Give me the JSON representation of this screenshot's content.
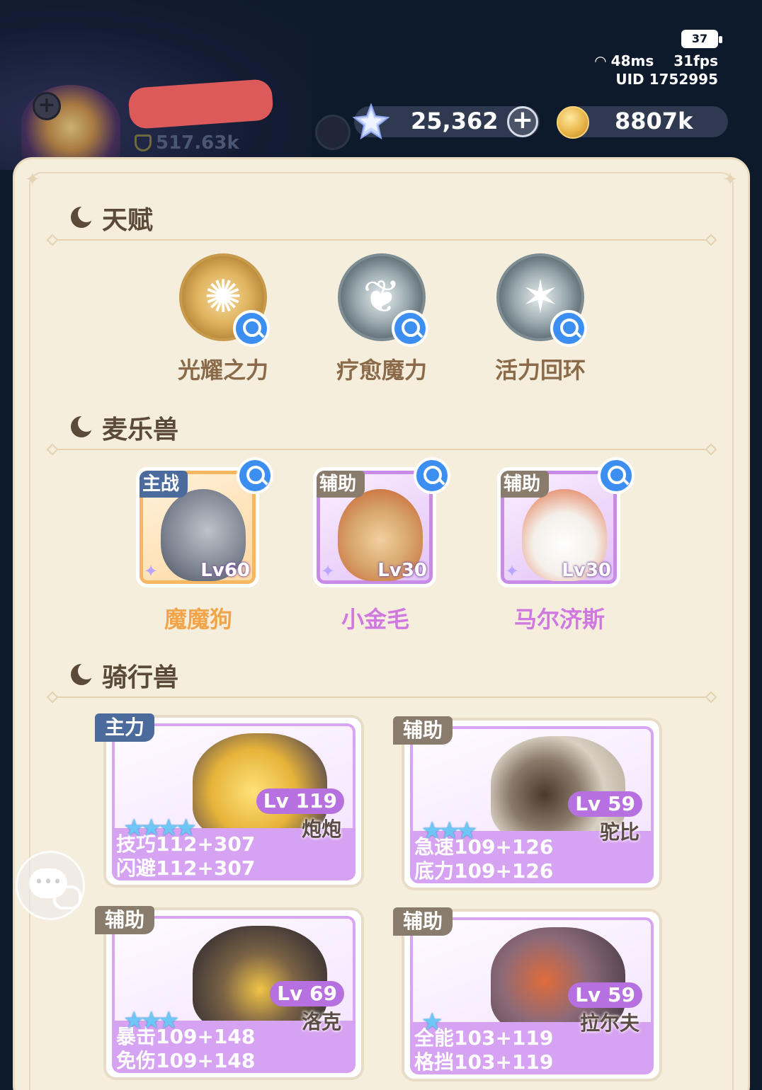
{
  "hud": {
    "power": "517.63k",
    "battery": "37",
    "ping": "48ms",
    "fps": "31fps",
    "uid": "UID 1752995",
    "gems": "25,362",
    "gold": "8807k"
  },
  "talent": {
    "title": "天赋",
    "items": [
      {
        "label": "光耀之力",
        "style": "gold",
        "icon": "sun-compass-icon"
      },
      {
        "label": "疗愈魔力",
        "style": "silver",
        "icon": "leaf-icon"
      },
      {
        "label": "活力回环",
        "style": "silver",
        "icon": "star-burst-icon"
      }
    ]
  },
  "pets": {
    "title": "麦乐兽",
    "items": [
      {
        "role": "主战",
        "level": "Lv60",
        "name": "魔魔狗"
      },
      {
        "role": "辅助",
        "level": "Lv30",
        "name": "小金毛"
      },
      {
        "role": "辅助",
        "level": "Lv30",
        "name": "马尔济斯"
      }
    ]
  },
  "mounts": {
    "title": "骑行兽",
    "items": [
      {
        "role": "主力",
        "level": "Lv 119",
        "name": "炮炮",
        "stars": "★★★★",
        "stat1": "技巧112+307",
        "stat2": "闪避112+307"
      },
      {
        "role": "辅助",
        "level": "Lv 59",
        "name": "驼比",
        "stars": "★★★",
        "stat1": "急速109+126",
        "stat2": "底力109+126"
      },
      {
        "role": "辅助",
        "level": "Lv 69",
        "name": "洛克",
        "stars": "★★★",
        "stat1": "暴击109+148",
        "stat2": "免伤109+148"
      },
      {
        "role": "辅助",
        "level": "Lv 59",
        "name": "拉尔夫",
        "stars": "★",
        "stat1": "全能103+119",
        "stat2": "格挡103+119"
      }
    ]
  },
  "colors": {
    "panel_bg": "#f5eedd",
    "section_title": "#5a4a37",
    "talent_label": "#8a6a48",
    "pet_name_orange": "#f0a54a",
    "pet_name_purple": "#cf78e0",
    "mount_stat_bg": "#d6a2f2",
    "magnifier_blue": "#3c8ef0"
  }
}
